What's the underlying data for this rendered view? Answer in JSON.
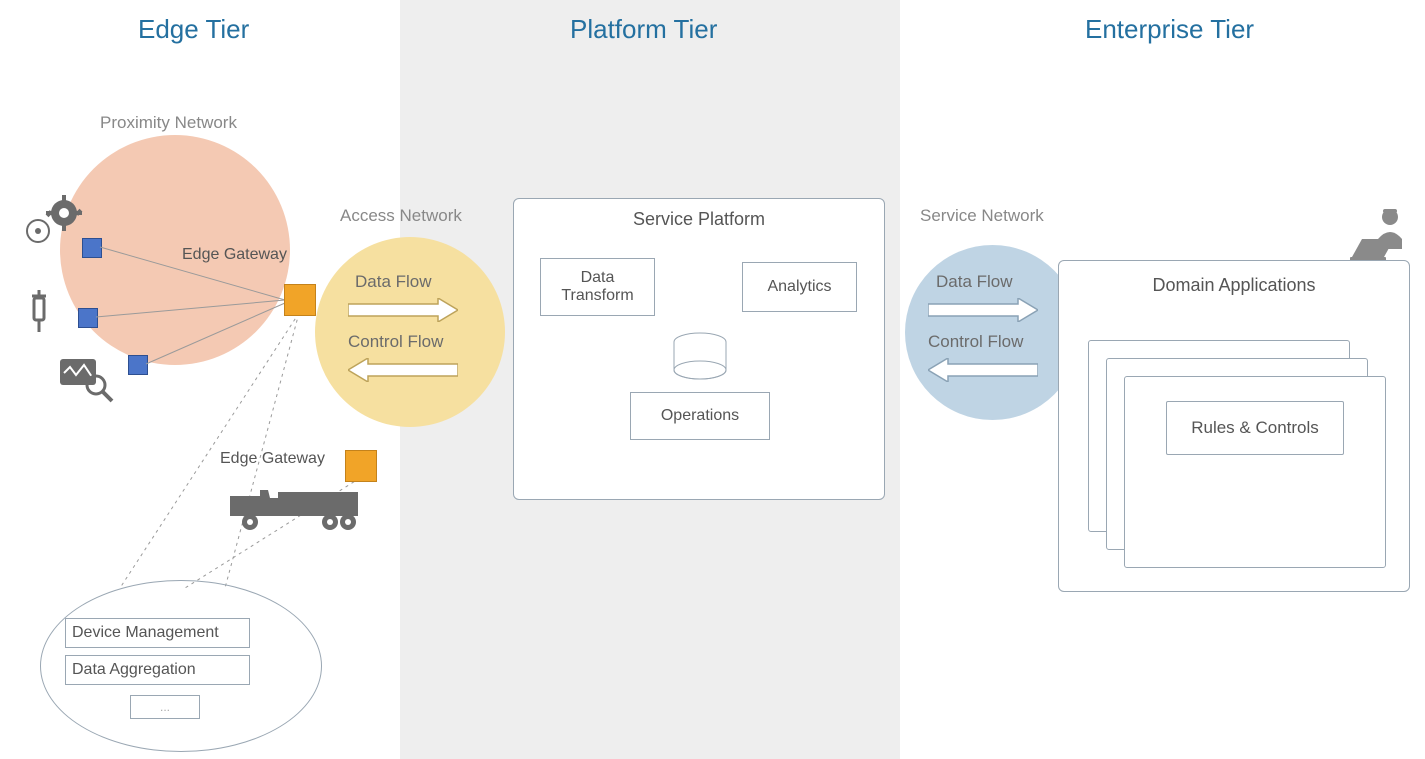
{
  "tiers": {
    "edge": "Edge Tier",
    "platform": "Platform Tier",
    "enterprise": "Enterprise Tier"
  },
  "networks": {
    "proximity": "Proximity Network",
    "access": "Access Network",
    "service": "Service Network"
  },
  "edge": {
    "gateway_label_1": "Edge Gateway",
    "gateway_label_2": "Edge Gateway",
    "device_management": "Device Management",
    "data_aggregation": "Data Aggregation",
    "ellipsis": "..."
  },
  "platform": {
    "panel_title": "Service Platform",
    "data_transform": "Data\nTransform",
    "analytics": "Analytics",
    "operations": "Operations"
  },
  "flows": {
    "data_flow": "Data Flow",
    "control_flow": "Control Flow"
  },
  "enterprise": {
    "panel_title": "Domain Applications",
    "rules_controls": "Rules & Controls"
  },
  "colors": {
    "proximity_circle": "#f4c9b3",
    "access_circle": "#f6e0a0",
    "service_circle": "#bfd4e4",
    "gateway": "#f1a428",
    "tier_heading": "#2470a0"
  }
}
